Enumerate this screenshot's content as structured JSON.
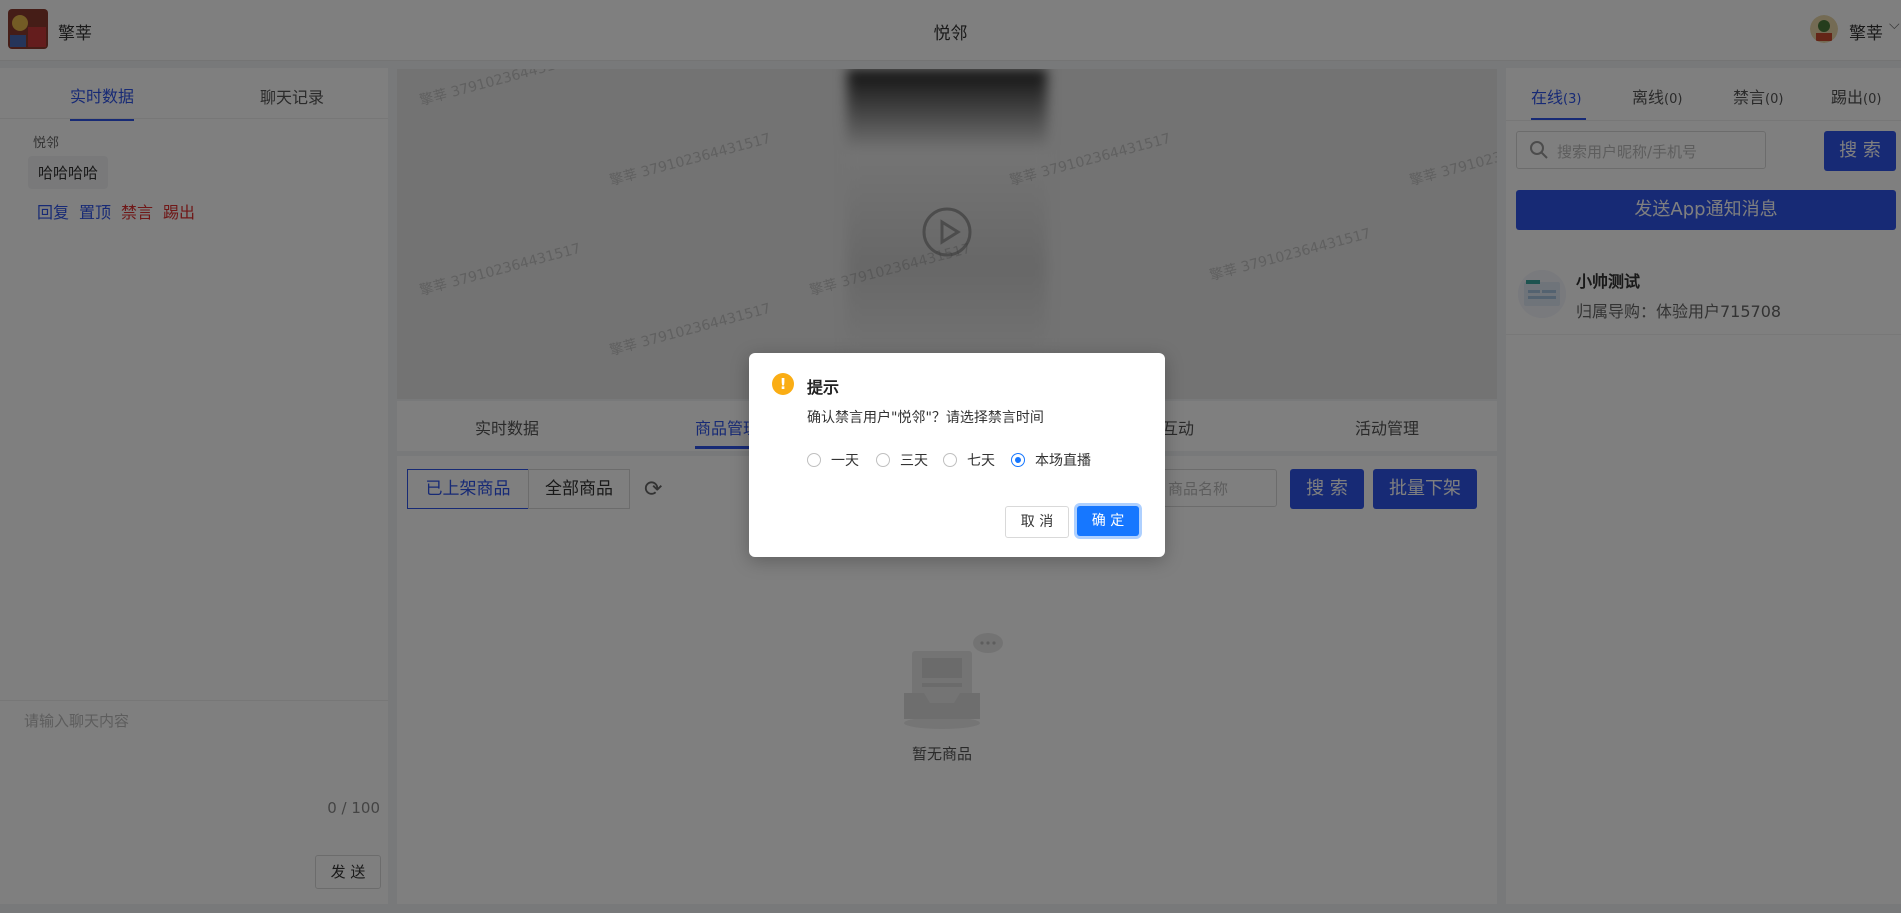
{
  "header": {
    "username": "擎莘",
    "center_title": "悦邻"
  },
  "left_panel": {
    "tabs": [
      "实时数据",
      "聊天记录"
    ],
    "message": {
      "author": "悦邻",
      "text": "哈哈哈哈"
    },
    "actions": [
      "回复",
      "置顶",
      "禁言",
      "踢出"
    ],
    "input_placeholder": "请输入聊天内容",
    "counter": "0 / 100",
    "send_label": "发 送"
  },
  "video": {
    "watermark": "擎莘 379102364431517"
  },
  "middle_tabs": [
    "实时数据",
    "商品管理",
    "互动",
    "活动管理"
  ],
  "products": {
    "filters": [
      "已上架商品",
      "全部商品"
    ],
    "search_placeholder": "商品名称",
    "search_label": "搜 索",
    "batch_label": "批量下架",
    "empty_text": "暂无商品"
  },
  "right_panel": {
    "tabs": [
      {
        "label": "在线",
        "count": "(3)"
      },
      {
        "label": "离线",
        "count": "(0)"
      },
      {
        "label": "禁言",
        "count": "(0)"
      },
      {
        "label": "踢出",
        "count": "(0)"
      }
    ],
    "search_placeholder": "搜索用户昵称/手机号",
    "search_label": "搜 索",
    "notify_label": "发送App通知消息",
    "member": {
      "name": "小帅测试",
      "sub": "归属导购：体验用户715708"
    }
  },
  "dialog": {
    "title": "提示",
    "message": "确认禁言用户\"悦邻\"？请选择禁言时间",
    "options": [
      "一天",
      "三天",
      "七天",
      "本场直播"
    ],
    "selected_option": "本场直播",
    "cancel_label": "取 消",
    "ok_label": "确 定"
  },
  "colors": {
    "primary": "#2f54eb",
    "danger": "#e03030",
    "dialog_primary": "#1677ff",
    "warning": "#faad14"
  }
}
